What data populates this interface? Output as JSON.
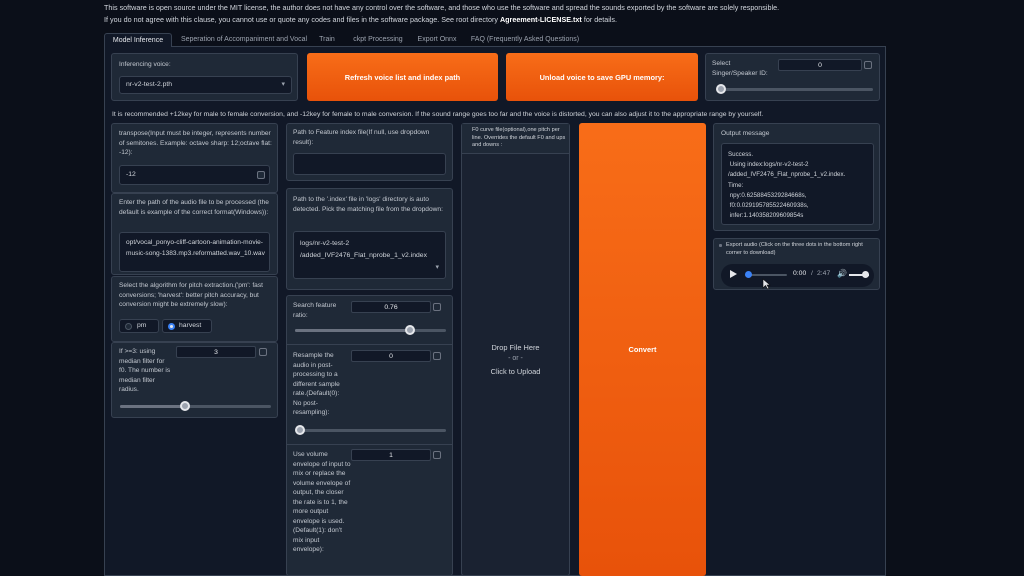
{
  "notice": {
    "line1": "This software is open source under the MIT license, the author does not have any control over the software, and those who use the software and spread the sounds exported by the software are solely responsible.",
    "line2_pre": "If you do not agree with this clause, you cannot use or quote any codes and files in the software package. See root directory",
    "line2_bold": "Agreement-LICENSE.txt",
    "line2_post": "for details."
  },
  "tabs": [
    {
      "label": "Model Inference"
    },
    {
      "label": "Seperation of Accompaniment and Vocal"
    },
    {
      "label": "Train"
    },
    {
      "label": "ckpt Processing"
    },
    {
      "label": "Export Onnx"
    },
    {
      "label": "FAQ (Frequently Asked Questions)"
    }
  ],
  "voice": {
    "label": "Inferencing voice:",
    "selected": "nr-v2-test-2.pth"
  },
  "buttons": {
    "refresh": "Refresh voice list and index path",
    "unload": "Unload voice to save GPU memory:",
    "convert": "Convert"
  },
  "speaker": {
    "label": "Select Singer/Speaker ID:",
    "value": "0",
    "slider_fraction": 0.0
  },
  "recommendation": "It is recommended +12key for male to female conversion, and -12key for female to male conversion. If the sound range goes too far and the voice is distorted, you can also adjust it to the appropriate range by yourself.",
  "transpose": {
    "label": "transpose(Input must be integer, represents number of semitones. Example: octave sharp: 12;octave flat: -12):",
    "value": "-12"
  },
  "audio_path": {
    "label": "Enter the path of the audio file to be processed (the default is example of the correct format(Windows)):",
    "value": "opt/vocal_ponyo-cliff-cartoon-animation-movie-music-song-1383.mp3.reformatted.wav_10.wav"
  },
  "pitch_algo": {
    "label": "Select the algorithm for pitch extraction.('pm': fast conversions; 'harvest': better pitch accuracy, but conversion might be extremely slow):",
    "options": [
      "pm",
      "harvest"
    ],
    "selected": "harvest"
  },
  "median": {
    "label": "If >=3: using median filter for f0. The number is median filter radius.",
    "value": "3",
    "slider_fraction": 0.43
  },
  "feature_index": {
    "label": "Path to Feature index file(If null, use dropdown result):",
    "value": ""
  },
  "index_dropdown": {
    "label": "Path to the '.index' file in 'logs' directory is auto detected. Pick the matching file from the dropdown:",
    "value": "logs/nr-v2-test-2 /added_IVF2476_Flat_nprobe_1_v2.index"
  },
  "search_ratio": {
    "label": "Search feature ratio:",
    "value": "0.76",
    "slider_fraction": 0.76
  },
  "resample": {
    "label": "Resample the audio in post-processing to a different sample rate.(Default(0): No post-resampling):",
    "value": "0",
    "slider_fraction": 0.0
  },
  "volume_env": {
    "label": "Use volume envelope of input to mix or replace the volume envelope of output, the closer the rate is to 1, the more output envelope is used.(Default(1): don't mix input envelope):",
    "value": "1"
  },
  "f0_file": {
    "label": "F0 curve file(optional),one pitch per line. Overrides the default F0 and ups and downs :",
    "drop_line1": "Drop File Here",
    "drop_line2": "- or -",
    "drop_line3": "Click to Upload"
  },
  "output": {
    "label": "Output message",
    "message": "Success.\n Using index:logs/nr-v2-test-2\n/added_IVF2476_Flat_nprobe_1_v2.index.\nTime:\n npy:0.6258845329284668s,\n f0:0.029195785522460938s,\n infer:1.140358209609854s"
  },
  "export_audio": {
    "label": "Export audio (Click on the three dots in the bottom right corner to download)",
    "time_current": "0:00",
    "time_separator": "/",
    "time_total": "2:47",
    "progress_fraction": 0.0,
    "volume_fraction": 1.0
  }
}
